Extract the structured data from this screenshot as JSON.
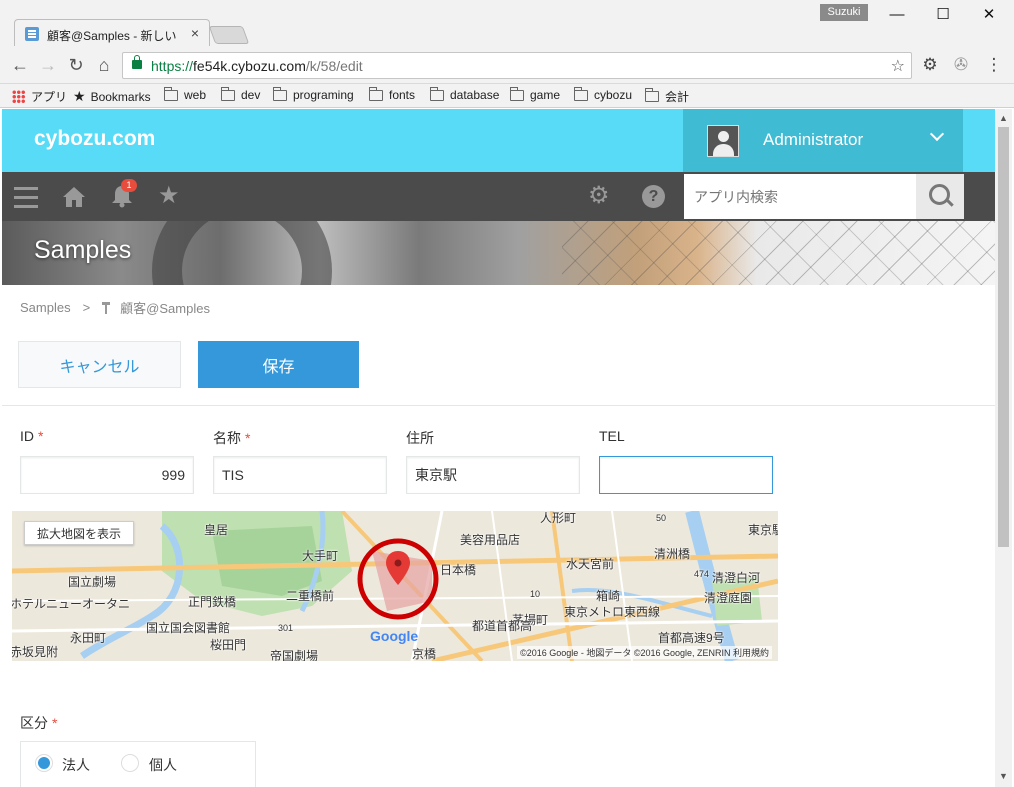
{
  "browser": {
    "tab_title": "顧客@Samples - 新しいレ",
    "tab_close": "×",
    "user_chip": "Suzuki",
    "window_buttons": [
      "—",
      "☐",
      "✕"
    ],
    "url_scheme": "https://",
    "url_host": "fe54k.cybozu.com",
    "url_path": "/k/58/edit",
    "bookmarks": [
      {
        "label": "アプリ",
        "icon": "apps-icon"
      },
      {
        "label": "Bookmarks",
        "icon": "star-icon"
      },
      {
        "label": "web",
        "icon": "folder-icon"
      },
      {
        "label": "dev",
        "icon": "folder-icon"
      },
      {
        "label": "programing",
        "icon": "folder-icon"
      },
      {
        "label": "fonts",
        "icon": "folder-icon"
      },
      {
        "label": "database",
        "icon": "folder-icon"
      },
      {
        "label": "game",
        "icon": "folder-icon"
      },
      {
        "label": "cybozu",
        "icon": "folder-icon"
      },
      {
        "label": "会計",
        "icon": "folder-icon"
      }
    ]
  },
  "header": {
    "logo": "cybozu.com",
    "user_name": "Administrator",
    "notification_count": "1",
    "search_placeholder": "アプリ内検索"
  },
  "app": {
    "title": "Samples",
    "breadcrumb": {
      "space": "Samples",
      "separator": ">",
      "app": "顧客@Samples"
    }
  },
  "actions": {
    "cancel": "キャンセル",
    "save": "保存"
  },
  "fields": [
    {
      "label": "ID",
      "required": true,
      "value": "999"
    },
    {
      "label": "名称",
      "required": true,
      "value": "TIS"
    },
    {
      "label": "住所",
      "required": false,
      "value": "東京駅"
    },
    {
      "label": "TEL",
      "required": false,
      "value": ""
    }
  ],
  "required_mark": "*",
  "map": {
    "open_larger": "拡大地図を表示",
    "labels": [
      "皇居",
      "大手町",
      "美容用品店",
      "人形町",
      "東京駅",
      "国立劇場",
      "ホテルニューオータニ",
      "正門鉄橋",
      "二重橋前",
      "日本橋",
      "水天宮前",
      "清洲橋",
      "清澄庭園",
      "国立国会図書館",
      "永田町",
      "桜田門",
      "帝国劇場",
      "京橋",
      "茅場町",
      "箱崎",
      "首都高速9号",
      "474",
      "301",
      "50",
      "10",
      "赤坂見附",
      "清澄白河",
      "東京メトロ東西線",
      "都道首都高"
    ],
    "logo": "Google",
    "copyright": "©2016 Google - 地図データ ©2016 Google, ZENRIN   利用規約"
  },
  "kubun": {
    "label": "区分",
    "options": [
      {
        "label": "法人",
        "checked": true
      },
      {
        "label": "個人",
        "checked": false
      }
    ]
  },
  "colors": {
    "header_cyan": "#57dbf7",
    "nav_dark": "#4b4b4b",
    "accent_blue": "#3498db",
    "required_red": "#e74c3c"
  }
}
